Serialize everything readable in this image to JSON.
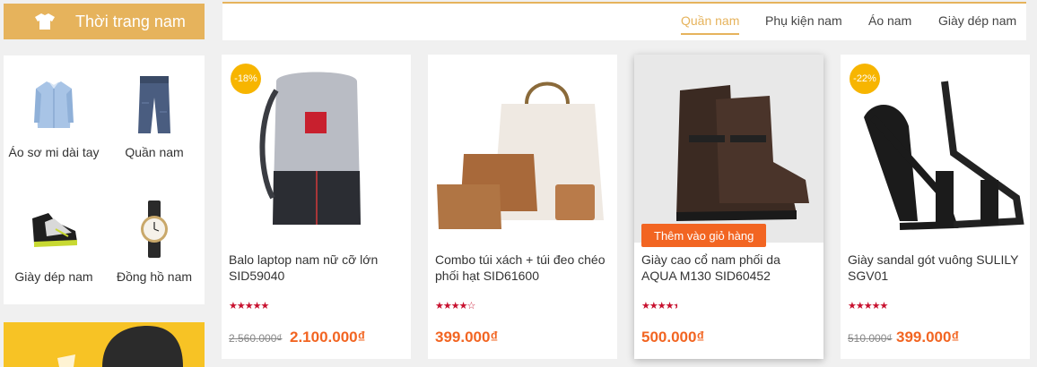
{
  "category": {
    "title": "Thời trang nam",
    "icon": "shirt-icon"
  },
  "subcategories": [
    {
      "label": "Áo sơ mi dài tay",
      "icon": "dress-shirt-icon"
    },
    {
      "label": "Quần nam",
      "icon": "jeans-icon"
    },
    {
      "label": "Giày dép nam",
      "icon": "sneaker-icon"
    },
    {
      "label": "Đồng hồ nam",
      "icon": "watch-icon"
    }
  ],
  "tabs": [
    {
      "label": "Quần nam",
      "active": true
    },
    {
      "label": "Phụ kiện nam",
      "active": false
    },
    {
      "label": "Áo nam",
      "active": false
    },
    {
      "label": "Giày dép nam",
      "active": false
    }
  ],
  "products": [
    {
      "name": "Balo laptop nam nữ cỡ lớn SID59040",
      "discount": "-18%",
      "old_price": "2.560.000₫",
      "price": "2.100.000₫",
      "rating": 5,
      "image": "backpack-image"
    },
    {
      "name": "Combo túi xách + túi đeo chéo phối hạt SID61600",
      "discount": "",
      "old_price": "",
      "price": "399.000₫",
      "rating": 4,
      "image": "handbag-set-image"
    },
    {
      "name": "Giày cao cổ nam phối da AQUA M130 SID60452",
      "discount": "",
      "old_price": "",
      "price": "500.000₫",
      "rating": 4.5,
      "image": "boots-image",
      "cart_button": "Thêm vào giỏ hàng"
    },
    {
      "name": "Giày sandal gót vuông SULILY SGV01",
      "discount": "-22%",
      "old_price": "510.000₫",
      "price": "399.000₫",
      "rating": 5,
      "image": "sandal-image"
    }
  ],
  "colors": {
    "accent": "#e6b35c",
    "price": "#f26522",
    "star": "#c8102e",
    "badge": "#f7b500"
  }
}
